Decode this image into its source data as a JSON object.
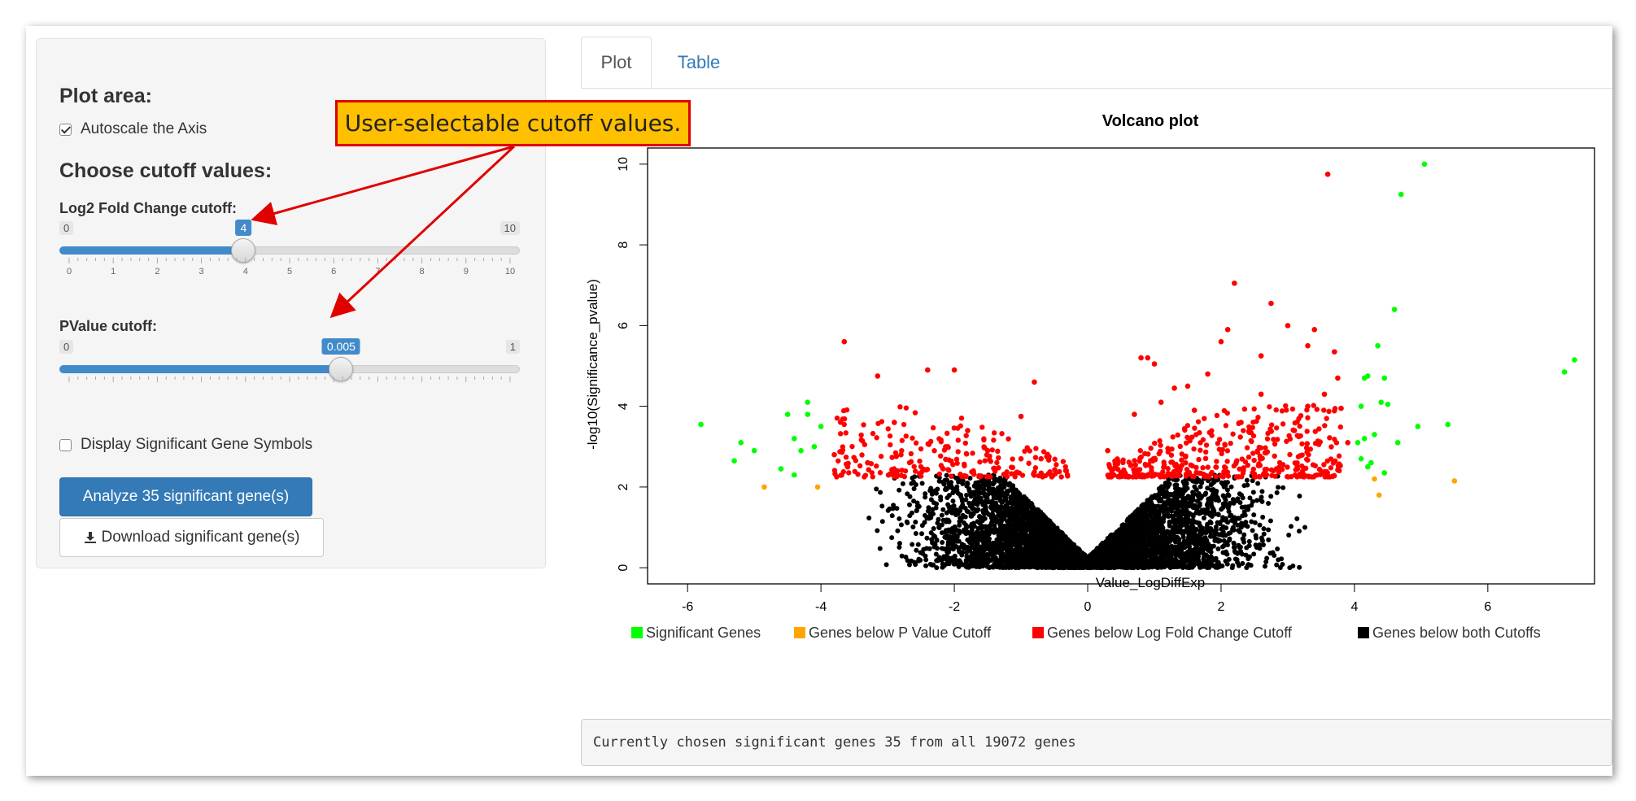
{
  "sidebar": {
    "plot_area_heading": "Plot area:",
    "autoscale_label": "Autoscale the Axis",
    "cutoff_heading": "Choose cutoff values:",
    "logfc": {
      "label": "Log2 Fold Change cutoff:",
      "min": "0",
      "max": "10",
      "value": "4",
      "fraction": 0.4,
      "ticks": [
        "0",
        "1",
        "2",
        "3",
        "4",
        "5",
        "6",
        "7",
        "8",
        "9",
        "10"
      ]
    },
    "pvalue": {
      "label": "PValue cutoff:",
      "min": "0",
      "max": "1",
      "value": "0.005",
      "fraction": 0.612
    },
    "gene_symbols_label": "Display Significant Gene Symbols",
    "analyze_button": "Analyze 35 significant gene(s)",
    "download_button": "Download significant gene(s)"
  },
  "tabs": {
    "plot": "Plot",
    "table": "Table"
  },
  "annotation": {
    "text": "User-selectable cutoff values."
  },
  "status_text": "Currently chosen significant genes 35 from all 19072 genes",
  "colors": {
    "significant": "#00ff00",
    "p_below": "#ffa500",
    "fc_below": "#ff0000",
    "both_below": "#000000",
    "primary": "#337ab7"
  },
  "chart_data": {
    "type": "scatter",
    "title": "Volcano plot",
    "xlabel": "Value_LogDiffExp",
    "ylabel": "-log10(Significance_pvalue)",
    "xlim": [
      -6.6,
      7.6
    ],
    "ylim": [
      -0.4,
      10.4
    ],
    "xticks": [
      -6,
      -4,
      -2,
      0,
      2,
      4,
      6
    ],
    "yticks": [
      0,
      2,
      4,
      6,
      8,
      10
    ],
    "legend_position": "bottom",
    "series": [
      {
        "name": "Significant Genes",
        "color": "#00ff00",
        "points": [
          [
            -5.8,
            3.55
          ],
          [
            -5.2,
            3.1
          ],
          [
            -5.3,
            2.65
          ],
          [
            -5.0,
            2.9
          ],
          [
            -4.5,
            3.8
          ],
          [
            -4.4,
            3.2
          ],
          [
            -4.2,
            4.1
          ],
          [
            -4.3,
            2.9
          ],
          [
            -4.1,
            3.0
          ],
          [
            -4.0,
            3.5
          ],
          [
            -4.6,
            2.45
          ],
          [
            -4.4,
            2.3
          ],
          [
            -4.2,
            3.8
          ],
          [
            4.1,
            4.0
          ],
          [
            4.15,
            4.7
          ],
          [
            4.2,
            4.75
          ],
          [
            4.1,
            2.7
          ],
          [
            4.15,
            3.2
          ],
          [
            4.3,
            3.3
          ],
          [
            4.2,
            2.5
          ],
          [
            4.35,
            5.5
          ],
          [
            4.4,
            4.1
          ],
          [
            4.45,
            4.7
          ],
          [
            4.5,
            4.05
          ],
          [
            4.45,
            2.35
          ],
          [
            4.6,
            6.4
          ],
          [
            4.65,
            3.1
          ],
          [
            4.7,
            9.25
          ],
          [
            4.95,
            3.5
          ],
          [
            5.05,
            10.0
          ],
          [
            5.4,
            3.55
          ],
          [
            7.15,
            4.85
          ],
          [
            7.3,
            5.15
          ],
          [
            4.05,
            3.1
          ],
          [
            4.25,
            2.6
          ]
        ]
      },
      {
        "name": "Genes below P Value Cutoff",
        "color": "#ffa500",
        "points": [
          [
            -4.85,
            2.0
          ],
          [
            -4.05,
            2.0
          ],
          [
            4.3,
            2.2
          ],
          [
            4.37,
            1.8
          ],
          [
            5.5,
            2.15
          ]
        ]
      },
      {
        "name": "Genes below Log Fold Change Cutoff",
        "color": "#ff0000",
        "points": [
          [
            -3.65,
            5.6
          ],
          [
            -3.15,
            4.75
          ],
          [
            -2.4,
            4.9
          ],
          [
            -2.0,
            4.9
          ],
          [
            -1.0,
            3.75
          ],
          [
            -0.8,
            4.6
          ],
          [
            0.8,
            5.2
          ],
          [
            0.9,
            5.2
          ],
          [
            1.0,
            5.05
          ],
          [
            1.5,
            4.5
          ],
          [
            1.8,
            4.8
          ],
          [
            2.0,
            5.6
          ],
          [
            2.1,
            5.9
          ],
          [
            2.2,
            7.05
          ],
          [
            2.6,
            5.25
          ],
          [
            2.75,
            6.55
          ],
          [
            3.0,
            6.0
          ],
          [
            3.3,
            5.5
          ],
          [
            3.4,
            5.9
          ],
          [
            3.6,
            9.75
          ],
          [
            3.7,
            5.35
          ],
          [
            3.55,
            4.3
          ],
          [
            3.75,
            4.7
          ],
          [
            -2.9,
            3.6
          ],
          [
            -2.1,
            3.0
          ],
          [
            -1.5,
            2.9
          ],
          [
            -0.7,
            2.7
          ],
          [
            -3.3,
            2.6
          ],
          [
            -3.8,
            2.8
          ],
          [
            3.8,
            3.95
          ],
          [
            3.3,
            4.0
          ],
          [
            2.6,
            4.3
          ],
          [
            1.3,
            4.45
          ],
          [
            -3.6,
            2.5
          ],
          [
            -2.8,
            2.8
          ],
          [
            -1.8,
            3.4
          ],
          [
            -1.0,
            2.7
          ],
          [
            0.7,
            3.8
          ],
          [
            1.1,
            4.1
          ],
          [
            1.6,
            3.9
          ],
          [
            2.3,
            3.6
          ],
          [
            3.1,
            3.4
          ],
          [
            3.9,
            3.1
          ],
          [
            0.3,
            2.9
          ]
        ]
      },
      {
        "name": "Genes below both Cutoffs",
        "color": "#000000",
        "points": []
      }
    ],
    "region_summary": {
      "both_below_count_note": "dense cloud",
      "fc_below_count_note": "dense cloud"
    }
  }
}
